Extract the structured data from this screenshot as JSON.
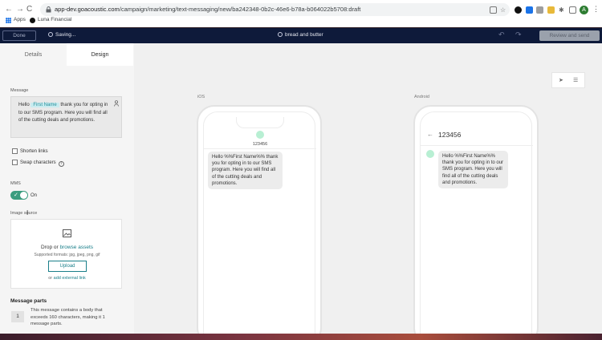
{
  "browser": {
    "url_host": "app-dev.goacoustic.com",
    "url_path": "/campaign/marketing/text-messaging/new/ba242348-0b2c-46e6-b78a-b064022b5708:draft",
    "profile_initial": "A",
    "bookmarks": [
      "Apps",
      "Luna Financial"
    ]
  },
  "header": {
    "done_label": "Done",
    "saving_label": "Saving...",
    "title": "bread and butter",
    "review_label": "Review and send"
  },
  "tabs": [
    "Details",
    "Design"
  ],
  "message": {
    "label": "Message",
    "text_before": "Hello ",
    "chip": "First Name",
    "text_after": " thank you for opting in to our SMS program.  Here you will find all of the cutting deals and promotions."
  },
  "options": {
    "shorten_links": "Shorten links",
    "swap_characters": "Swap characters"
  },
  "mms": {
    "label": "MMS",
    "toggle_state": "On",
    "image_source_label": "Image source",
    "drop_text": "Drop or ",
    "browse_link": "browse assets",
    "formats": "Supported formats: jpg, jpeg, png, gif",
    "upload_label": "Upload",
    "or_text": "or ",
    "external_link": "add external link"
  },
  "parts": {
    "title": "Message parts",
    "count": "1",
    "description": "This message contains a body that exceeds 160 characters, making it 1 message parts."
  },
  "preview": {
    "ios_label": "iOS",
    "android_label": "Android",
    "number": "123456",
    "message": "Hello %%First Name%% thank you for opting in to our SMS program.  Here you will find all of the cutting deals and promotions."
  }
}
